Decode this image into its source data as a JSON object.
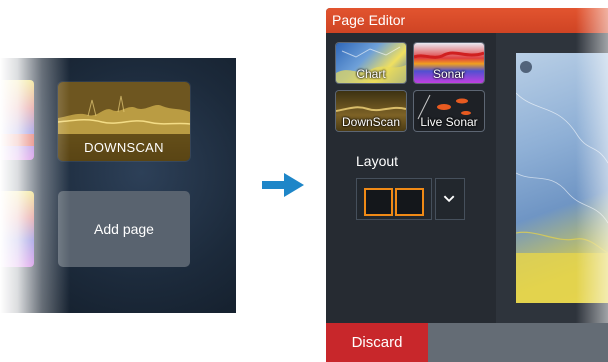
{
  "home": {
    "tiles": [
      {
        "label": "DOWNSCAN"
      },
      {
        "label": "Add page"
      }
    ]
  },
  "editor": {
    "title": "Page Editor",
    "apps": [
      {
        "label": "Chart",
        "icon": "chart-app-icon"
      },
      {
        "label": "Sonar",
        "icon": "sonar-app-icon"
      },
      {
        "label": "DownScan",
        "icon": "downscan-app-icon"
      },
      {
        "label": "Live Sonar",
        "icon": "live-sonar-app-icon"
      }
    ],
    "layout_label": "Layout",
    "discard_label": "Discard"
  },
  "colors": {
    "title_bar": "#e2542f",
    "discard": "#c8272b",
    "layout_accent": "#f08a16",
    "arrow": "#1e86c8"
  }
}
